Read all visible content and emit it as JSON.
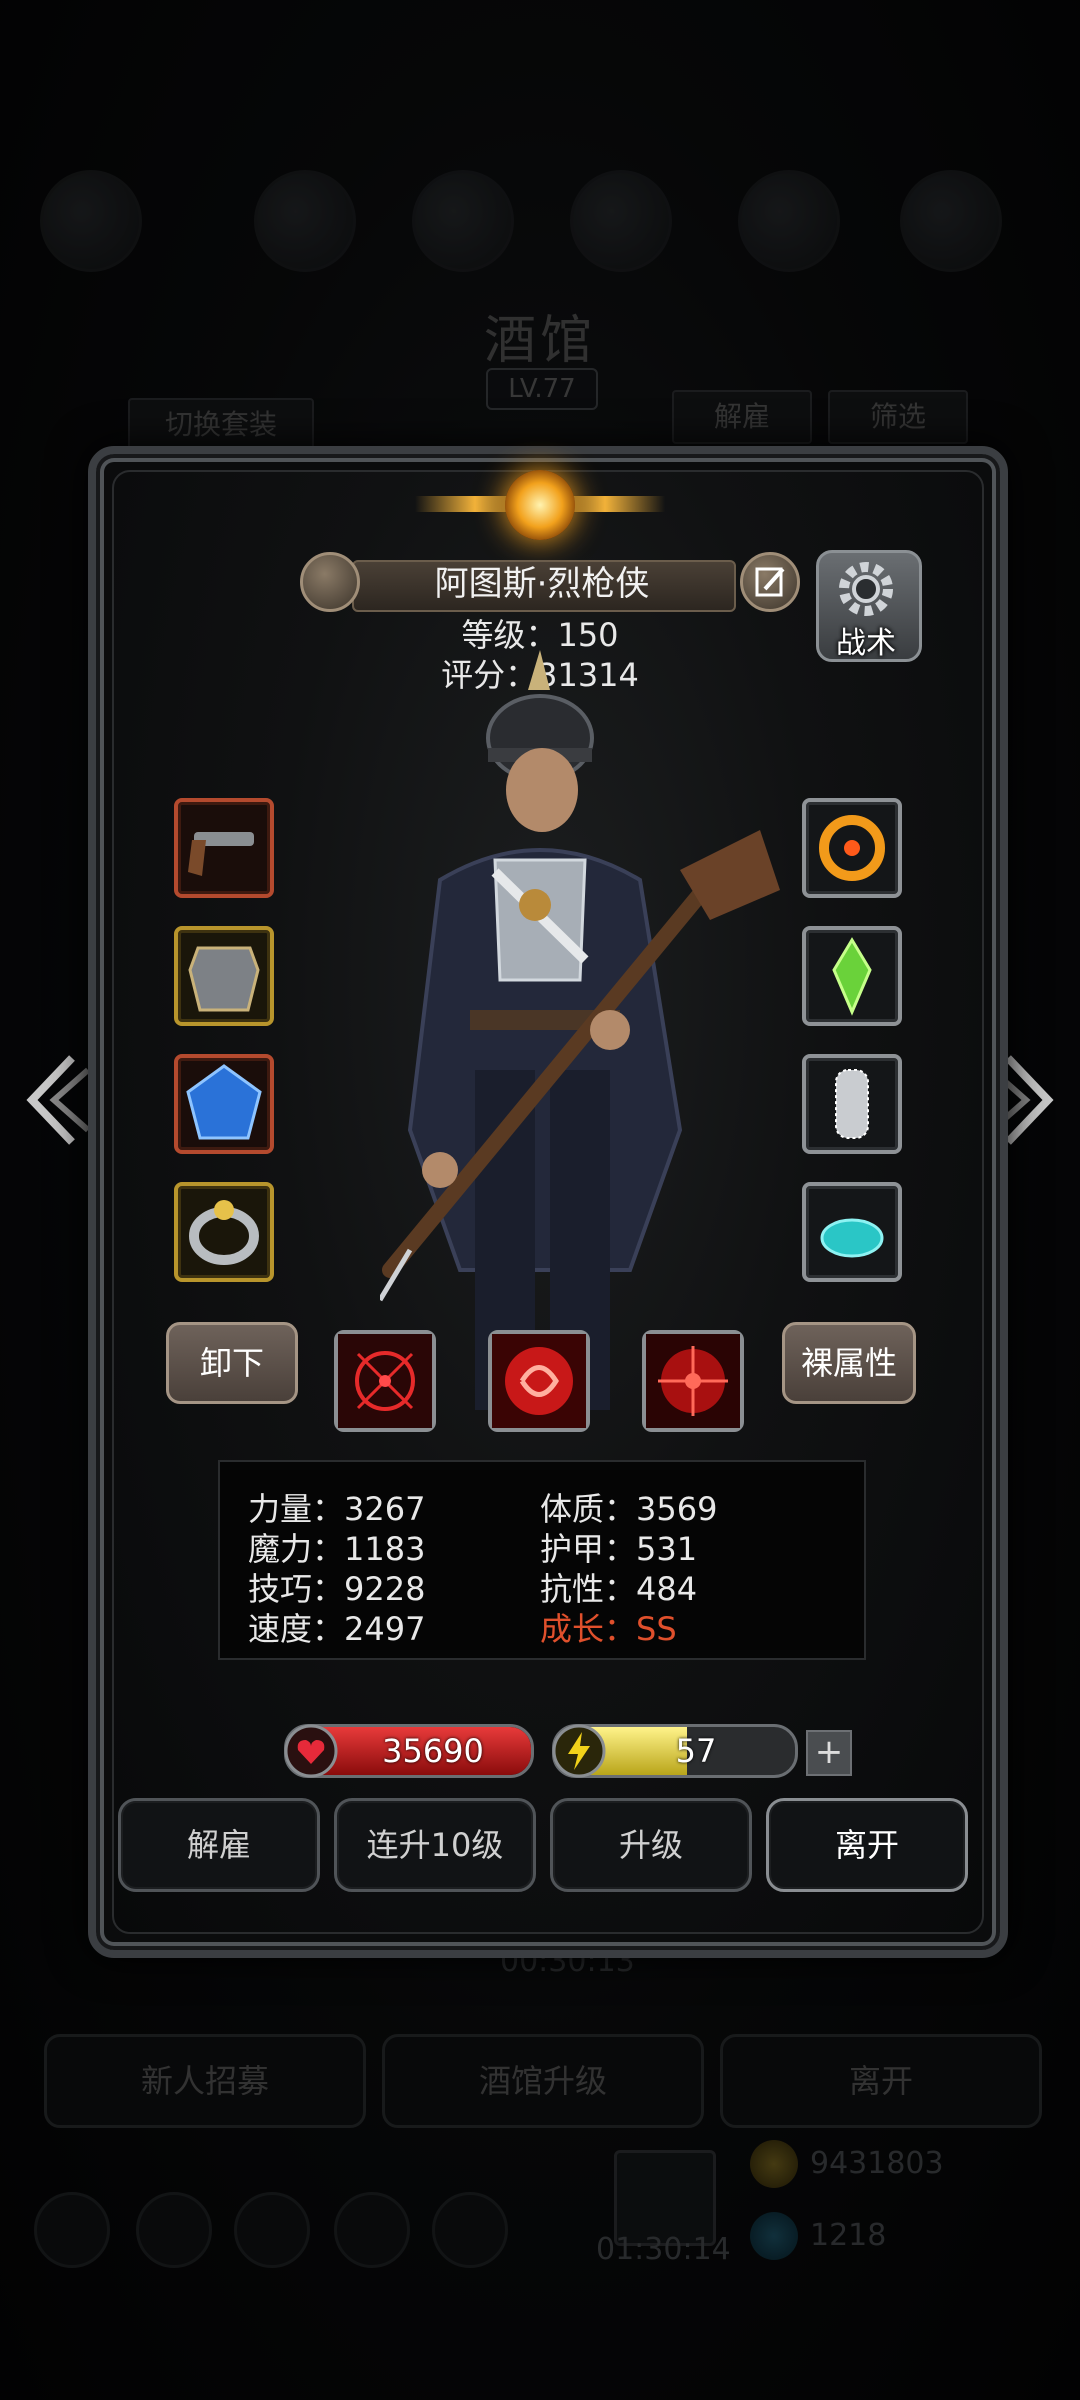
{
  "background": {
    "title": "酒馆",
    "level": "LV.77",
    "switch_outfit": "切换套装",
    "dismiss": "解雇",
    "filter": "筛选",
    "timer_top": "00:30:13",
    "recruit": "新人招募",
    "tavern_upgrade": "酒馆升级",
    "leave": "离开",
    "timer_bottom": "01:30:14",
    "gold": "9431803",
    "gems": "1218"
  },
  "hero": {
    "name": "阿图斯·烈枪侠",
    "level_line": "等级：150",
    "score_line": "评分：31314",
    "tactics": "战术"
  },
  "equipment": {
    "left": [
      "pistol-icon",
      "armor-icon",
      "sapphire-icon",
      "ring-icon"
    ],
    "right": [
      "fire-wreath-icon",
      "green-crystal-icon",
      "chainmail-icon",
      "turquoise-stone-icon"
    ]
  },
  "actions": {
    "unequip": "卸下",
    "base_attributes": "裸属性"
  },
  "attributes": {
    "strength": "力量：3267",
    "constitution": "体质：3569",
    "magic": "魔力：1183",
    "armor": "护甲：531",
    "skill": "技巧：9228",
    "resistance": "抗性：484",
    "speed": "速度：2497",
    "growth": "成长：SS"
  },
  "bars": {
    "hp": "35690",
    "hp_fraction": 1.0,
    "energy": "57",
    "energy_fraction": 0.55
  },
  "buttons": {
    "dismiss": "解雇",
    "upgrade10": "连升10级",
    "upgrade": "升级",
    "leave": "离开"
  },
  "colors": {
    "growth": "#e0502c",
    "hp": "#d42a2a",
    "energy": "#e8d84a"
  }
}
